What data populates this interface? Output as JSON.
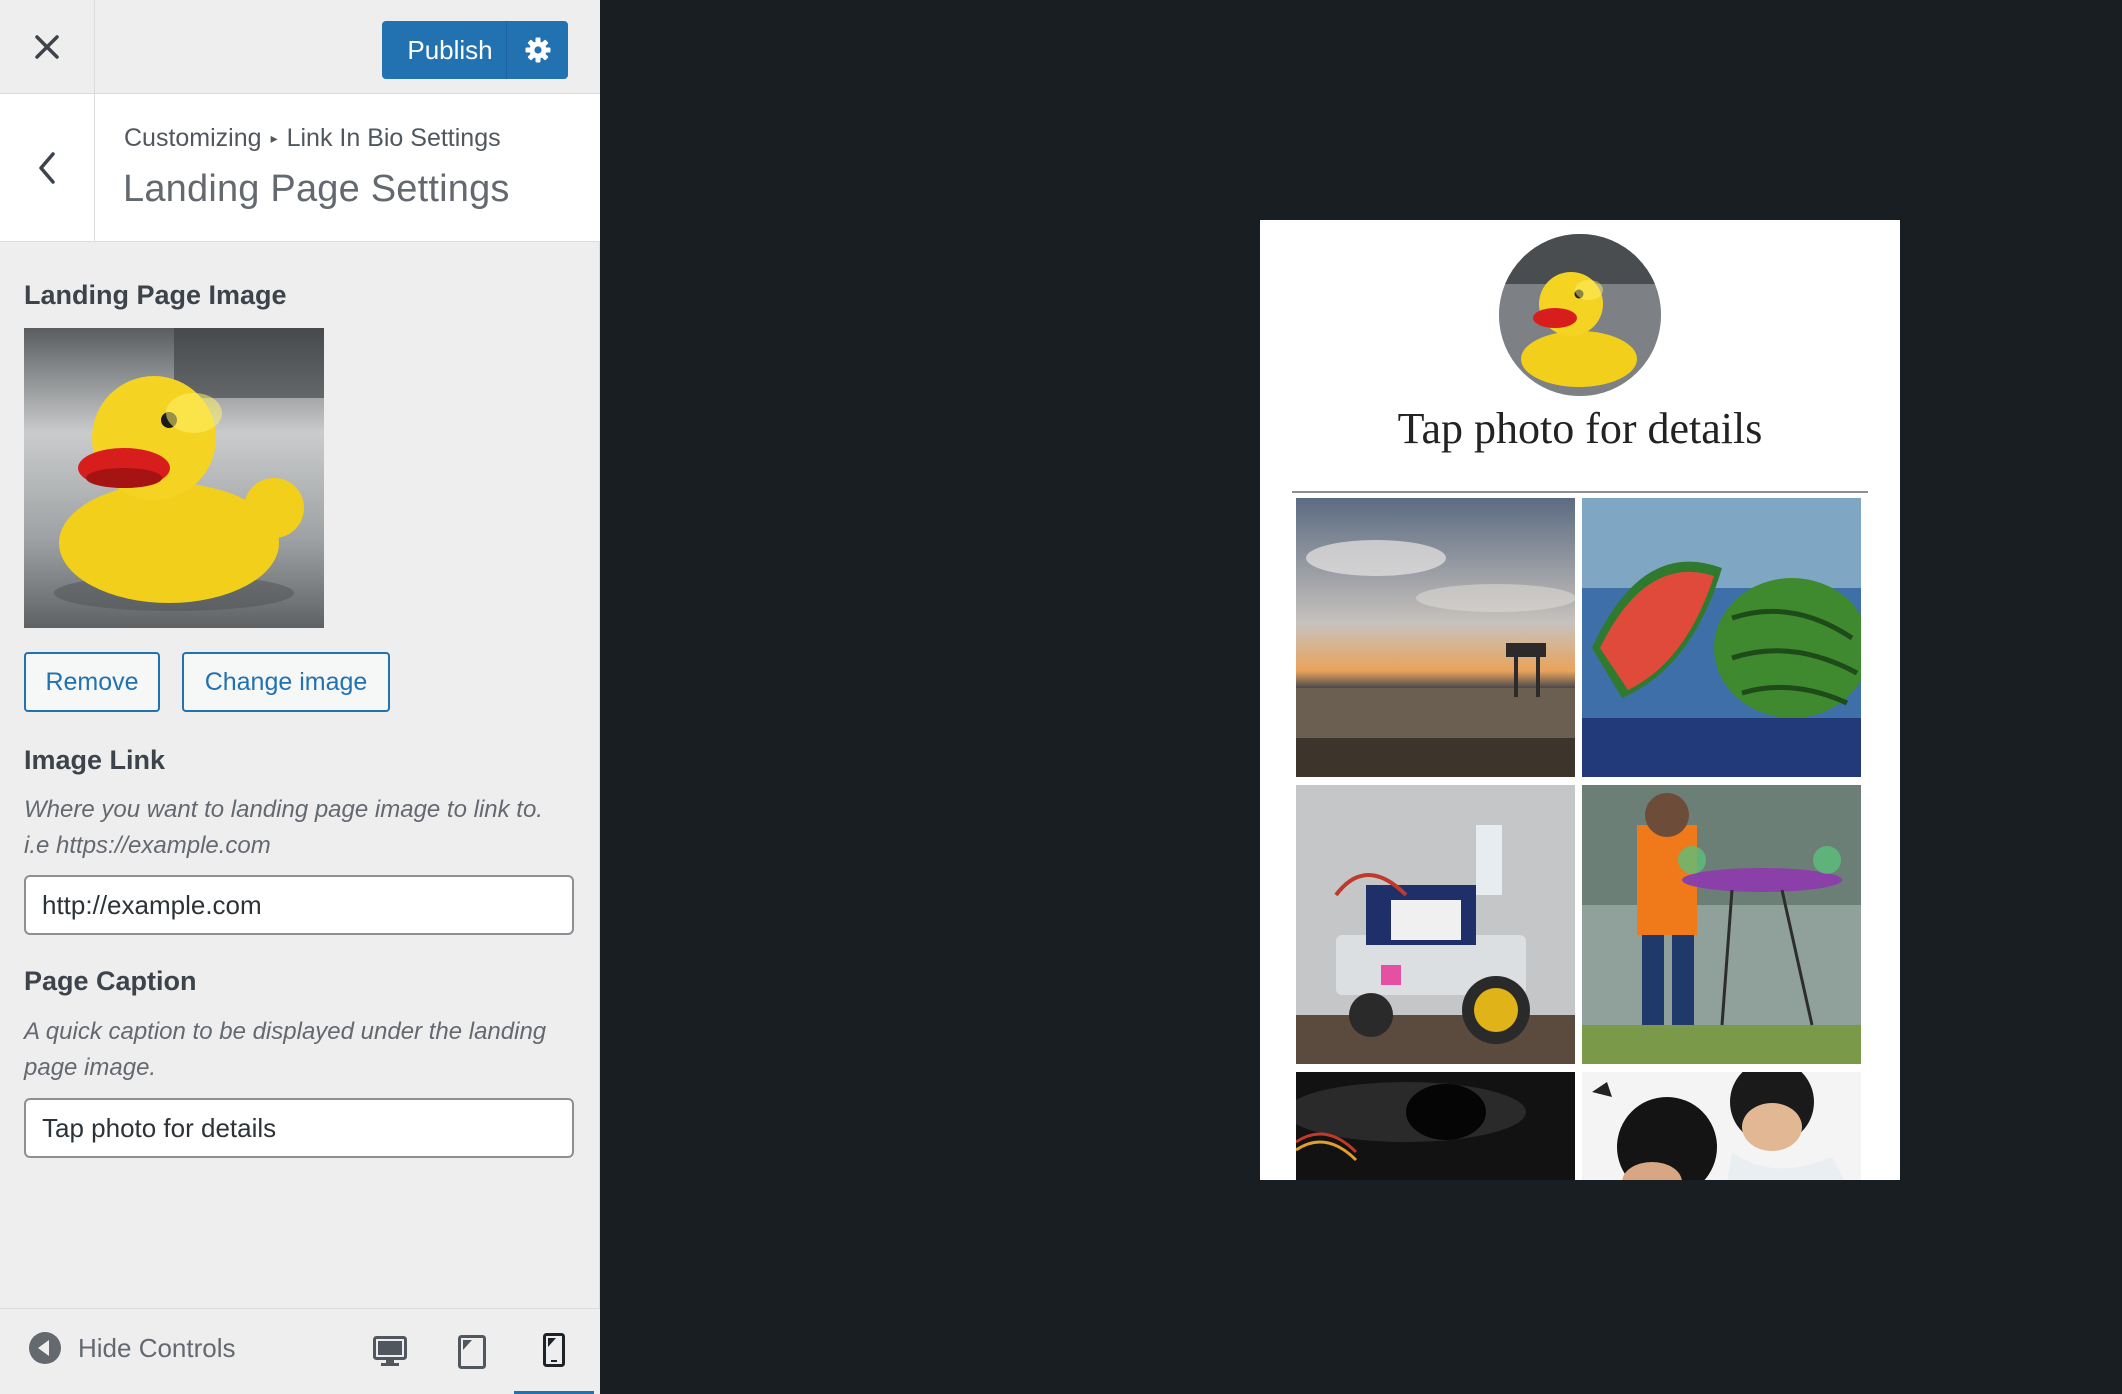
{
  "topbar": {
    "close_icon": "close-icon",
    "publish_label": "Publish",
    "settings_icon": "gear-icon"
  },
  "section": {
    "breadcrumb_root": "Customizing",
    "breadcrumb_separator": "▸",
    "breadcrumb_parent": "Link In Bio Settings",
    "title": "Landing Page Settings"
  },
  "controls": {
    "image_label": "Landing Page Image",
    "remove_label": "Remove",
    "change_label": "Change image",
    "link_label": "Image Link",
    "link_description": "Where you want to landing page image to link to. i.e https://example.com",
    "link_value": "http://example.com",
    "caption_label": "Page Caption",
    "caption_description": "A quick caption to be displayed under the landing page image.",
    "caption_value": "Tap photo for details"
  },
  "footer": {
    "hide_controls_label": "Hide Controls",
    "devices": [
      "desktop",
      "tablet",
      "mobile"
    ],
    "active_device": "mobile"
  },
  "preview": {
    "caption": "Tap photo for details",
    "tiles": [
      "sunset-beach",
      "watermelon-painting",
      "robot-car",
      "drone-pilot",
      "dark-electronics",
      "kids-reading"
    ]
  },
  "colors": {
    "accent": "#2271b1",
    "preview_bg": "#191e23",
    "sidebar_bg": "#eeeeee"
  }
}
